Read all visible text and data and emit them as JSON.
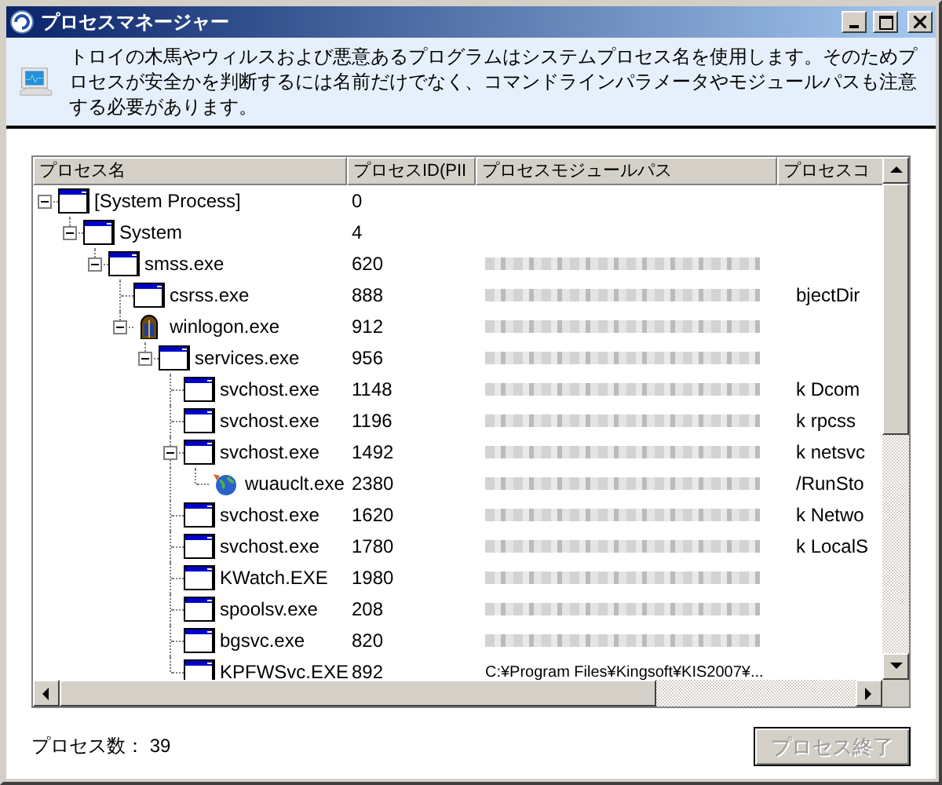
{
  "window": {
    "title": "プロセスマネージャー"
  },
  "header": {
    "message": "トロイの木馬やウィルスおよび悪意あるプログラムはシステムプロセス名を使用します。そのためプロセスが安全かを判断するには名前だけでなく、コマンドラインパラメータやモジュールパスも注意する必要があります。"
  },
  "table": {
    "columns": [
      "プロセス名",
      "プロセスID(PII",
      "プロセスモジュールパス",
      "プロセスコ"
    ],
    "rows": [
      {
        "kind": "window",
        "name": "[System Process]",
        "pid": "0",
        "expanded": true,
        "children": [
          {
            "kind": "window",
            "name": "System",
            "pid": "4",
            "expanded": true,
            "children": [
              {
                "kind": "window",
                "name": "smss.exe",
                "pid": "620",
                "path_blurred": true,
                "expanded": true,
                "children": [
                  {
                    "kind": "window",
                    "name": "csrss.exe",
                    "pid": "888",
                    "path_blurred": true,
                    "command": "bjectDir"
                  },
                  {
                    "kind": "winlogon",
                    "name": "winlogon.exe",
                    "pid": "912",
                    "path_blurred": true,
                    "expanded": true,
                    "children": [
                      {
                        "kind": "window",
                        "name": "services.exe",
                        "pid": "956",
                        "path_blurred": true,
                        "expanded": true,
                        "children": [
                          {
                            "kind": "window",
                            "name": "svchost.exe",
                            "pid": "1148",
                            "path_blurred": true,
                            "command": "k Dcom"
                          },
                          {
                            "kind": "window",
                            "name": "svchost.exe",
                            "pid": "1196",
                            "path_blurred": true,
                            "command": "k rpcss"
                          },
                          {
                            "kind": "window",
                            "name": "svchost.exe",
                            "pid": "1492",
                            "path_blurred": true,
                            "command": "k netsvc",
                            "expanded": true,
                            "children": [
                              {
                                "kind": "globe",
                                "name": "wuauclt.exe",
                                "pid": "2380",
                                "path_blurred": true,
                                "command": "/RunSto"
                              }
                            ]
                          },
                          {
                            "kind": "window",
                            "name": "svchost.exe",
                            "pid": "1620",
                            "path_blurred": true,
                            "command": "k Netwo"
                          },
                          {
                            "kind": "window",
                            "name": "svchost.exe",
                            "pid": "1780",
                            "path_blurred": true,
                            "command": "k LocalS"
                          },
                          {
                            "kind": "window",
                            "name": "KWatch.EXE",
                            "pid": "1980",
                            "path_blurred": true
                          },
                          {
                            "kind": "window",
                            "name": "spoolsv.exe",
                            "pid": "208",
                            "path_blurred": true
                          },
                          {
                            "kind": "window",
                            "name": "bgsvc.exe",
                            "pid": "820",
                            "path_blurred": true
                          },
                          {
                            "kind": "window",
                            "name": "KPFWSvc.EXE",
                            "pid": "892",
                            "path": "C:¥Program Files¥Kingsoft¥KIS2007¥..."
                          }
                        ]
                      }
                    ]
                  }
                ]
              }
            ]
          }
        ]
      }
    ]
  },
  "footer": {
    "process_count_label": "プロセス数：",
    "process_count": "39",
    "end_button": {
      "label": "プロセス終了",
      "disabled": true
    }
  }
}
